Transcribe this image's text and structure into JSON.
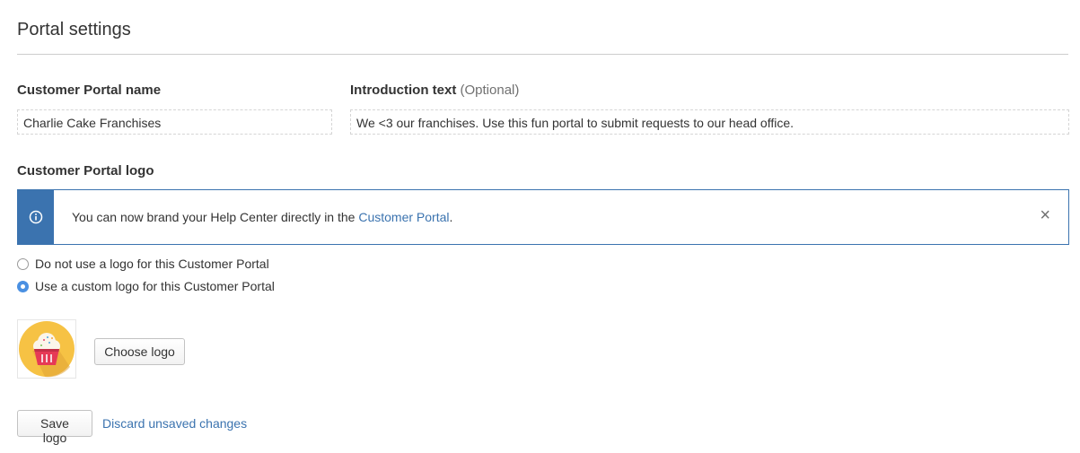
{
  "page": {
    "title": "Portal settings"
  },
  "portal_name": {
    "label": "Customer Portal name",
    "value": "Charlie Cake Franchises"
  },
  "intro": {
    "label": "Introduction text",
    "optional": "(Optional)",
    "value": "We <3 our franchises. Use this fun portal to submit requests to our head office."
  },
  "logo_section": {
    "label": "Customer Portal logo"
  },
  "banner": {
    "text": "You can now brand your Help Center directly in the",
    "link": "Customer Portal",
    "suffix": ".",
    "close": "×",
    "icon": "info-icon",
    "accent": "#3b73af"
  },
  "radios": [
    {
      "label": "Do not use a logo for this Customer Portal",
      "checked": false
    },
    {
      "label": "Use a custom logo for this Customer Portal",
      "checked": true
    }
  ],
  "logo": {
    "icon": "cupcake-icon",
    "choose_label": "Choose logo"
  },
  "actions": {
    "save_label": "Save logo",
    "discard_label": "Discard unsaved changes"
  }
}
